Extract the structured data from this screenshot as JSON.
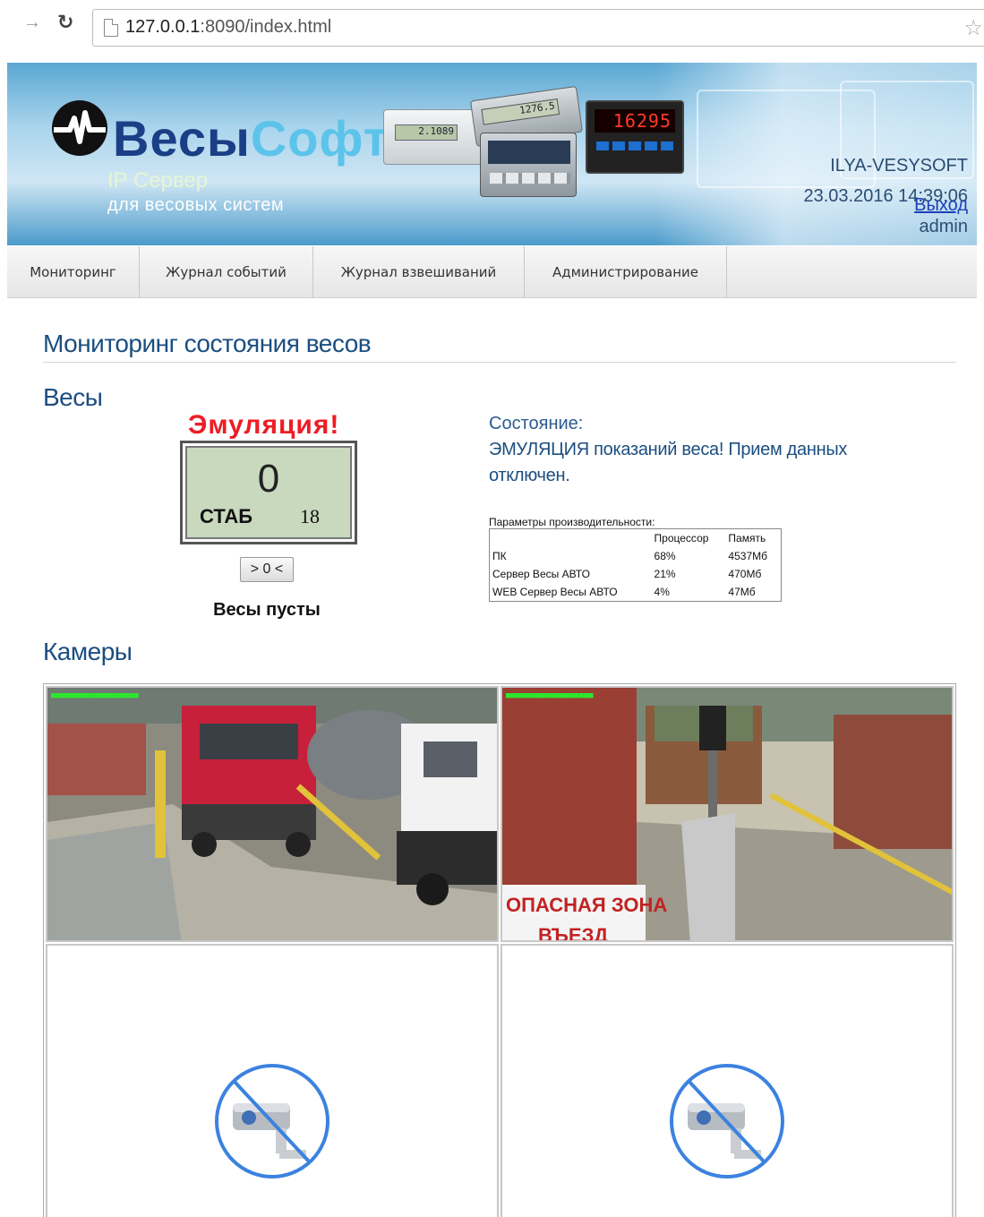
{
  "browser": {
    "url_host": "127.0.0.1",
    "url_rest": ":8090/index.html"
  },
  "header": {
    "logo_part1": "Весы",
    "logo_part2": "Софт",
    "tagline1": "IP Сервер",
    "tagline2": "для весовых систем",
    "device_readouts": [
      "2.1089",
      "1276.5",
      "16295"
    ],
    "hostname": "ILYA-VESYSOFT",
    "datetime": "23.03.2016 14:39:06",
    "username": "admin",
    "logout_label": "Выход"
  },
  "nav": {
    "tabs": [
      {
        "label": "Мониторинг"
      },
      {
        "label": "Журнал событий"
      },
      {
        "label": "Журнал взвешиваний"
      },
      {
        "label": "Администрирование"
      }
    ]
  },
  "main": {
    "page_title": "Мониторинг состояния весов",
    "scales_heading": "Весы",
    "emulation_label": "Эмуляция!",
    "indicator": {
      "value": "0",
      "stability": "СТАБ",
      "number": "18"
    },
    "zero_button": "> 0 <",
    "scales_state": "Весы пусты",
    "state_label": "Состояние:",
    "state_text": "ЭМУЛЯЦИЯ показаний веса! Прием данных отключен.",
    "perf": {
      "caption": "Параметры производительности:",
      "headers": [
        "",
        "Процессор",
        "Память"
      ],
      "rows": [
        [
          "ПК",
          "68%",
          "4537Мб"
        ],
        [
          "Сервер Весы АВТО",
          "21%",
          "470Мб"
        ],
        [
          "WEB Сервер Весы АВТО",
          "4%",
          "47Мб"
        ]
      ]
    },
    "cameras_heading": "Камеры",
    "cameras": [
      {
        "type": "feed",
        "scene": "weighbridge-truck"
      },
      {
        "type": "feed",
        "scene": "entrance-gate",
        "sign_line1": "ОПАСНАЯ ЗОНА",
        "sign_line2": "ВЪЕЗД"
      },
      {
        "type": "unavailable"
      },
      {
        "type": "unavailable"
      }
    ]
  },
  "colors": {
    "heading": "#1b4e80",
    "emulation": "#ee1c25",
    "lcd": "#c8d9bd",
    "link": "#1c3fb8"
  }
}
